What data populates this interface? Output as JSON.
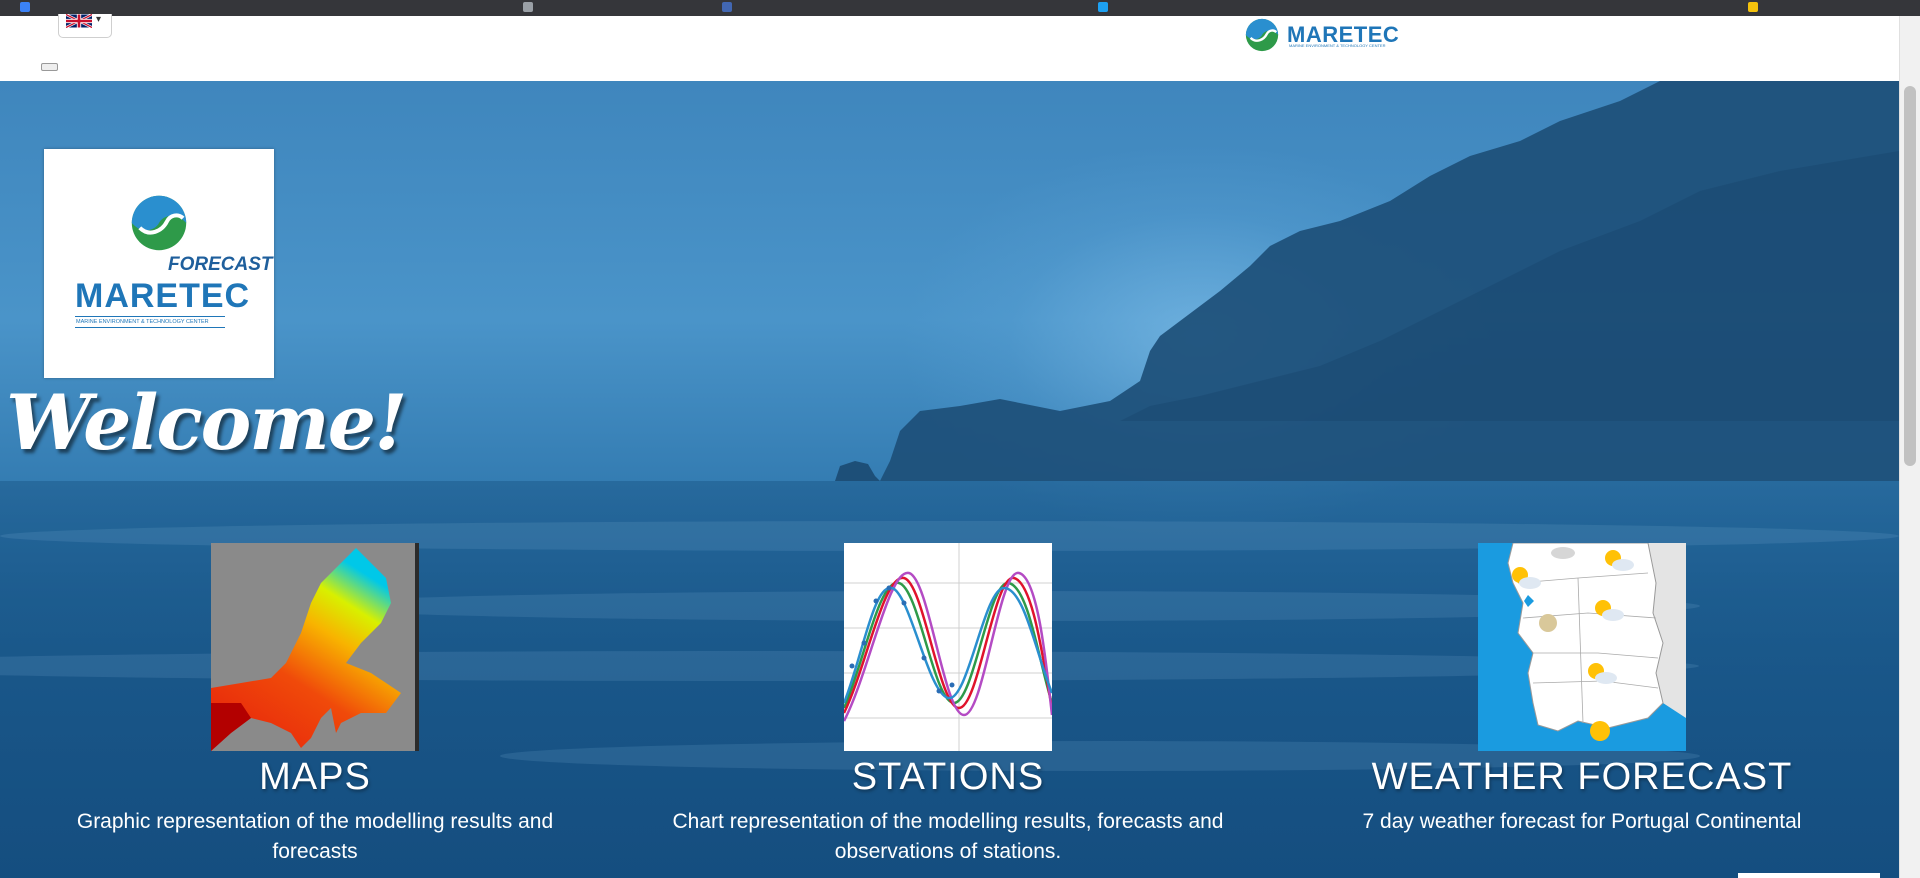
{
  "header": {
    "language_flag": "uk-flag-icon",
    "logo_text": "MARETEC",
    "logo_subtext": "MARINE ENVIRONMENT & TECHNOLOGY CENTER"
  },
  "hero": {
    "card_logo": {
      "forecast": "FORECAST",
      "name": "MARETEC",
      "subtitle": "MARINE ENVIRONMENT & TECHNOLOGY CENTER"
    },
    "welcome": "Welcome!"
  },
  "features": [
    {
      "title": "MAPS",
      "description": "Graphic representation of the modelling results and forecasts",
      "icon": "map-thumbnail"
    },
    {
      "title": "STATIONS",
      "description": "Chart representation of the modelling results, forecasts and observations of stations.",
      "icon": "chart-thumbnail"
    },
    {
      "title": "WEATHER FORECAST",
      "description": "7 day weather forecast for Portugal Continental",
      "icon": "weather-map-thumbnail"
    }
  ],
  "colors": {
    "brand_blue": "#1f76b8",
    "brand_green": "#2e9a49",
    "hero_blue": "#2f77ad"
  }
}
